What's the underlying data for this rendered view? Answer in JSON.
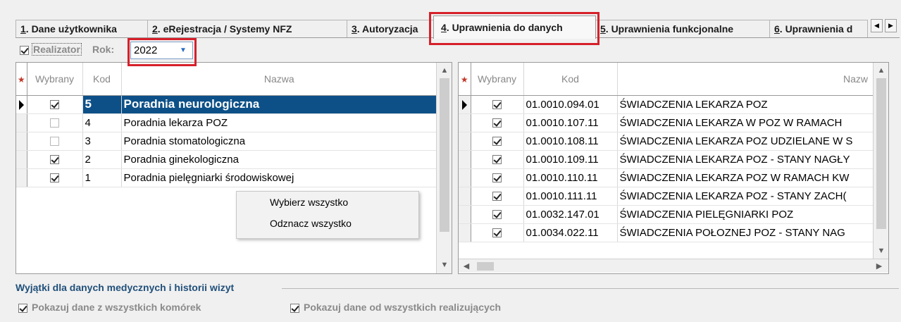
{
  "tabs": [
    {
      "num": "1",
      "label": ". Dane użytkownika"
    },
    {
      "num": "2",
      "label": ". eRejestracja / Systemy NFZ"
    },
    {
      "num": "3",
      "label": ". Autoryzacja"
    },
    {
      "num": "4",
      "label": ". Uprawnienia do danych"
    },
    {
      "num": "5",
      "label": ". Uprawnienia funkcjonalne"
    },
    {
      "num": "6",
      "label": ". Uprawnienia d"
    }
  ],
  "active_tab": 3,
  "filter": {
    "realizator_label": "Realizator",
    "realizator_checked": true,
    "rok_label": "Rok:",
    "year_value": "2022"
  },
  "left_grid": {
    "columns": [
      "Wybrany",
      "Kod",
      "Nazwa"
    ],
    "rows": [
      {
        "checked": true,
        "kod": "5",
        "nazwa": "Poradnia neurologiczna",
        "selected": true
      },
      {
        "checked": false,
        "kod": "4",
        "nazwa": "Poradnia lekarza POZ"
      },
      {
        "checked": false,
        "kod": "3",
        "nazwa": "Poradnia stomatologiczna"
      },
      {
        "checked": true,
        "kod": "2",
        "nazwa": "Poradnia ginekologiczna"
      },
      {
        "checked": true,
        "kod": "1",
        "nazwa": "Poradnia pielęgniarki środowiskowej"
      }
    ]
  },
  "context_menu": {
    "items": [
      "Wybierz wszystko",
      "Odznacz wszystko"
    ]
  },
  "right_grid": {
    "columns": [
      "Wybrany",
      "Kod",
      "Nazw"
    ],
    "rows": [
      {
        "checked": true,
        "kod": "01.0010.094.01",
        "nazwa": "ŚWIADCZENIA  LEKARZA  POZ"
      },
      {
        "checked": true,
        "kod": "01.0010.107.11",
        "nazwa": "ŚWIADCZENIA LEKARZA W POZ W RAMACH"
      },
      {
        "checked": true,
        "kod": "01.0010.108.11",
        "nazwa": "ŚWIADCZENIA LEKARZA POZ UDZIELANE W S"
      },
      {
        "checked": true,
        "kod": "01.0010.109.11",
        "nazwa": "ŚWIADCZENIA LEKARZA POZ - STANY NAGŁY"
      },
      {
        "checked": true,
        "kod": "01.0010.110.11",
        "nazwa": "ŚWIADCZENIA LEKARZA POZ W RAMACH  KW"
      },
      {
        "checked": true,
        "kod": "01.0010.111.11",
        "nazwa": "ŚWIADCZENIA LEKARZA POZ - STANY ZACH("
      },
      {
        "checked": true,
        "kod": "01.0032.147.01",
        "nazwa": "ŚWIADCZENIA  PIELĘGNIARKI  POZ"
      },
      {
        "checked": true,
        "kod": "01.0034.022.11",
        "nazwa": "ŚWIADCZENIA POŁOZNEJ POZ - STANY NAG"
      }
    ]
  },
  "exceptions": {
    "title": "Wyjątki dla danych medycznych i historii wizyt",
    "options": [
      {
        "label": "Pokazuj dane z wszystkich komórek",
        "checked": true
      },
      {
        "label": "Pokazuj dane od wszystkich realizujących",
        "checked": true
      }
    ]
  },
  "colors": {
    "selected_row": "#0d5088",
    "highlight": "#d6202a",
    "group_title": "#21507a"
  }
}
